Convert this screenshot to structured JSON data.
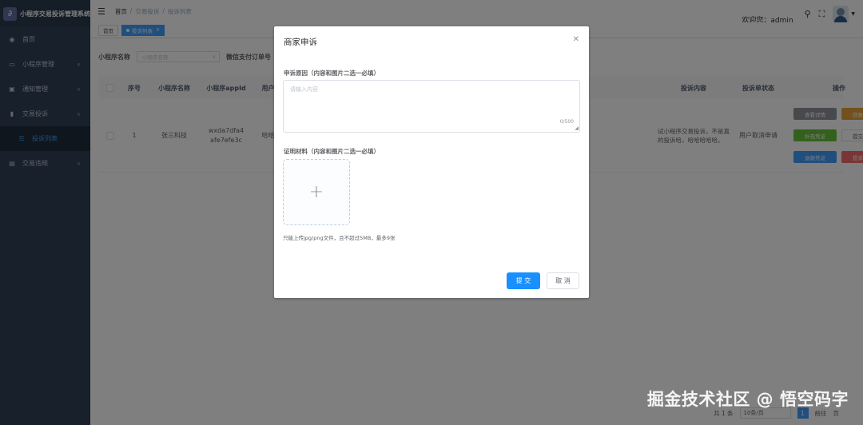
{
  "sidebar": {
    "title": "小程序交易投诉管理系统",
    "items": [
      {
        "label": "首页",
        "icon": "dashboard-icon",
        "has_children": false
      },
      {
        "label": "小程序管理",
        "icon": "monitor-icon",
        "has_children": true
      },
      {
        "label": "通知管理",
        "icon": "message-icon",
        "has_children": true
      },
      {
        "label": "交易投诉",
        "icon": "document-icon",
        "has_children": true
      },
      {
        "label": "投诉列表",
        "icon": "list-icon",
        "has_children": false,
        "sub": true
      },
      {
        "label": "交易违规",
        "icon": "folder-icon",
        "has_children": true
      }
    ]
  },
  "navbar": {
    "breadcrumb": [
      "首页",
      "交易投诉",
      "投诉列表"
    ],
    "welcome": "欢迎您：admin"
  },
  "tags": [
    {
      "label": "首页",
      "active": false
    },
    {
      "label": "投诉列表",
      "active": true
    }
  ],
  "filters": {
    "mini_program_label": "小程序名称",
    "mini_program_placeholder": "小程序名称",
    "order_label": "微信支付订单号"
  },
  "table": {
    "headers": [
      "序号",
      "小程序名称",
      "小程序appId",
      "用户",
      "投诉内容",
      "投诉单状态",
      "操作"
    ],
    "row": {
      "index": "1",
      "name": "张三科技",
      "appid": "wxda7dfa4afe7efe3c",
      "user": "哈哈",
      "content": "试小程序交易投诉，不是真的投诉哈，哈哈哈哈哈。",
      "status": "用户取消申请",
      "actions": [
        "查看详情",
        "回复处理",
        "补充凭证",
        "提交退款",
        "退款凭证",
        "投诉申诉"
      ]
    }
  },
  "pagination": {
    "total": "共 1 条",
    "page_size": "10条/页",
    "current": "1",
    "goto": "前往",
    "page_unit": "页"
  },
  "dialog": {
    "title": "商家申诉",
    "reason_label": "申诉原因（内容和图片二选一必填）",
    "reason_placeholder": "请输入内容",
    "reason_count": "0/500",
    "material_label": "证明材料（内容和图片二选一必填）",
    "upload_tip": "只能上传jpg/png文件，且不超过5MB，最多9张",
    "submit_label": "提 交",
    "cancel_label": "取 消"
  },
  "watermark": "掘金技术社区 @ 悟空码字",
  "colors": {
    "primary": "#1890ff",
    "sidebar": "#304156"
  }
}
